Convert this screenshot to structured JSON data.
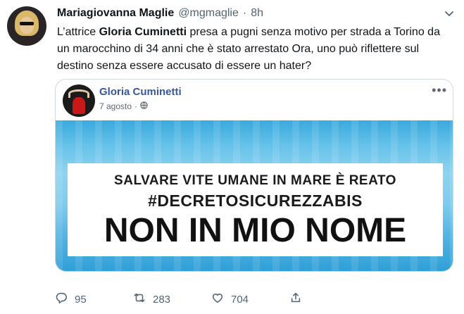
{
  "tweet": {
    "author_name": "Mariagiovanna Maglie",
    "handle": "@mgmaglie",
    "separator": "·",
    "time": "8h",
    "text_parts": {
      "p1": "L’attrice ",
      "bold": "Gloria Cuminetti",
      "p2": " presa a pugni senza motivo per strada a Torino da un marocchino di 34 anni che è stato arrestato Ora, uno può riflettere sul destino senza essere accusato di essere un hater?"
    }
  },
  "embed": {
    "fb_name": "Gloria Cuminetti",
    "fb_date": "7 agosto",
    "fb_separator": "·",
    "more_label": "•••",
    "banner": {
      "line1": "SALVARE VITE UMANE IN MARE È REATO",
      "line2": "#DECRETOSICUREZZABIS",
      "line3": "NON IN MIO NOME"
    }
  },
  "actions": {
    "reply_count": "95",
    "retweet_count": "283",
    "like_count": "704"
  },
  "icons": {
    "caret": "chevron-down-icon",
    "reply": "reply-icon",
    "retweet": "retweet-icon",
    "like": "heart-icon",
    "share": "share-icon",
    "globe": "globe-icon"
  },
  "colors": {
    "text": "#0f1419",
    "secondary": "#536471",
    "fb_link": "#385898",
    "banner": "#5fc0ea"
  }
}
